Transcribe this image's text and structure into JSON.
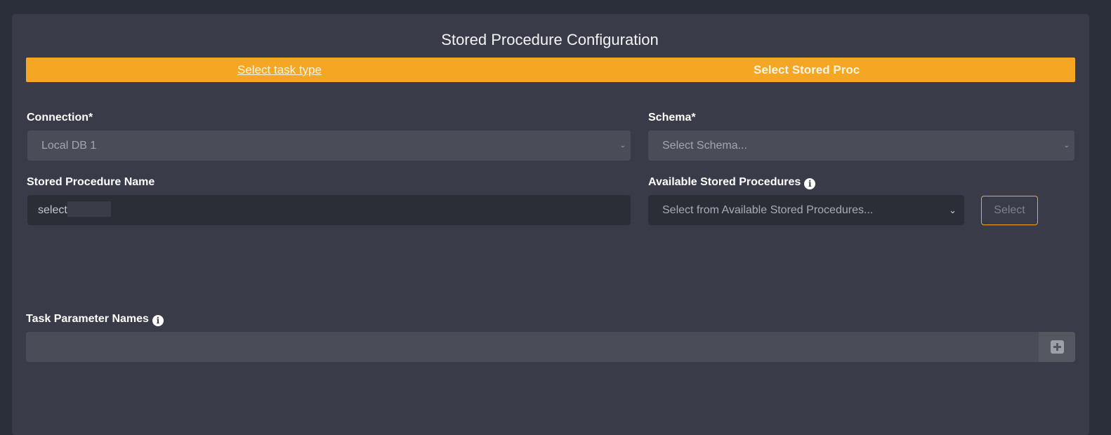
{
  "page": {
    "title": "Stored Procedure Configuration"
  },
  "stepper": {
    "step1_label": "Select task type",
    "step2_label": "Select Stored Proc"
  },
  "form": {
    "connection": {
      "label": "Connection*",
      "value": "Local DB 1"
    },
    "schema": {
      "label": "Schema*",
      "placeholder": "Select Schema..."
    },
    "stored_procedure_name": {
      "label": "Stored Procedure Name",
      "value": "select"
    },
    "available_stored_procedures": {
      "label": "Available Stored Procedures",
      "placeholder": "Select from Available Stored Procedures...",
      "select_button": "Select"
    },
    "task_parameter_names": {
      "label": "Task Parameter Names"
    }
  },
  "icons": {
    "info": "info-icon",
    "add": "plus-square-icon",
    "dropdown": "chevron-down-icon"
  },
  "colors": {
    "accent": "#f5a623",
    "background": "#2b2f39",
    "panel": "#393c48"
  }
}
